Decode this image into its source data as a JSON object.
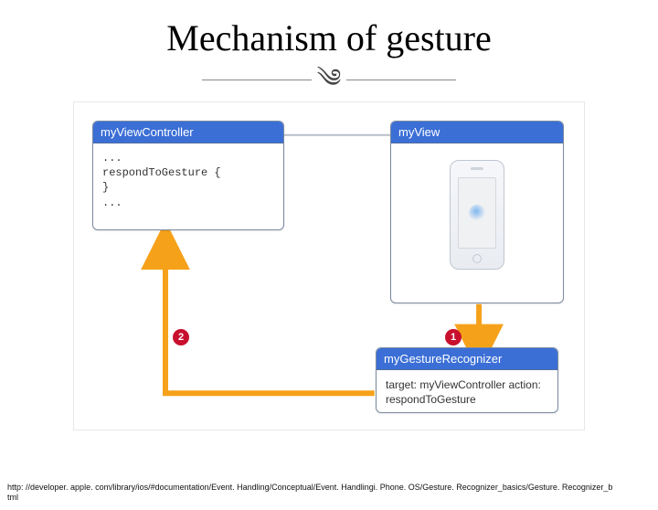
{
  "title": "Mechanism of gesture",
  "boxes": {
    "viewController": {
      "header": "myViewController",
      "code": "...\nrespondToGesture {\n}\n..."
    },
    "view": {
      "header": "myView"
    },
    "gestureRecognizer": {
      "header": "myGestureRecognizer",
      "detail": "target: myViewController\naction: respondToGesture"
    }
  },
  "badges": {
    "one": "1",
    "two": "2"
  },
  "footer": {
    "url": "http: //developer. apple. com/library/ios/#documentation/Event. Handling/Conceptual/Event. Handlingi. Phone. OS/Gesture. Recognizer_basics/Gesture. Recognizer_b",
    "url_cont": "tml"
  }
}
